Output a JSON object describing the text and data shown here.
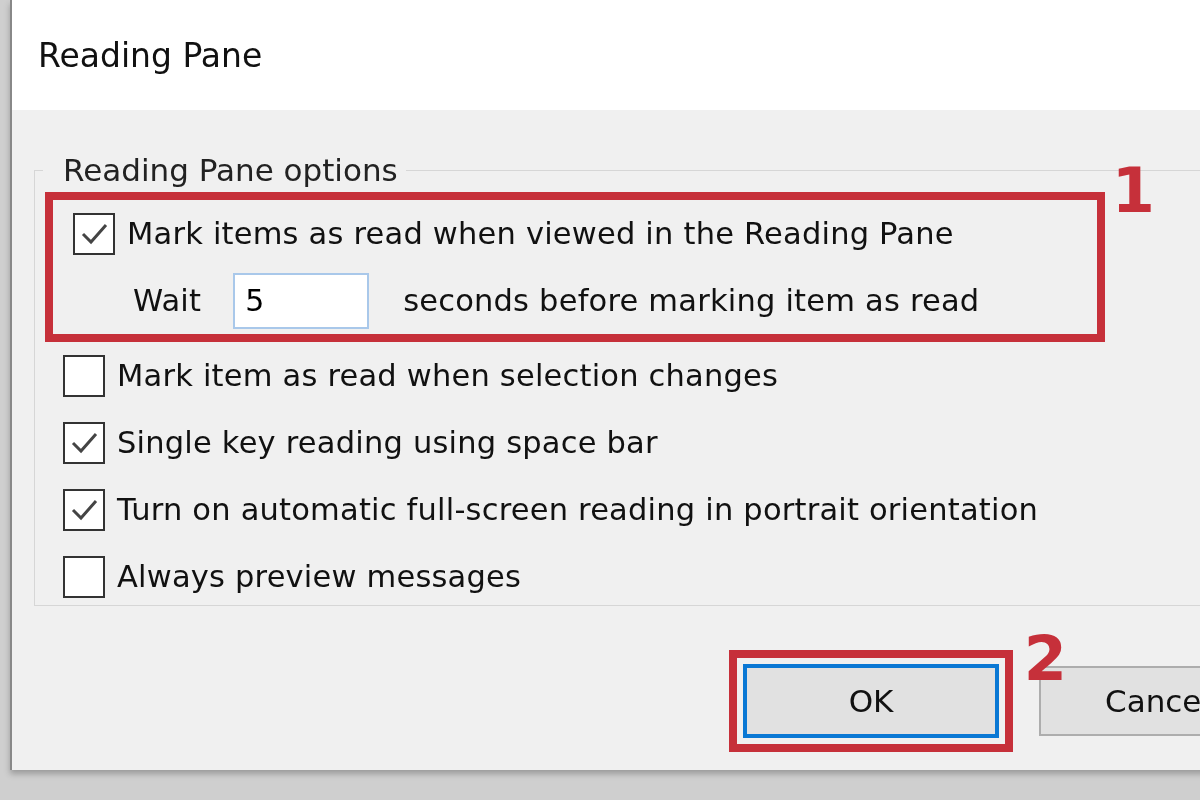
{
  "dialog": {
    "title": "Reading Pane"
  },
  "group": {
    "legend": "Reading Pane options",
    "options": [
      {
        "kind": "checkbox",
        "label": "Mark items as read when viewed in the Reading Pane",
        "checked": true
      },
      {
        "kind": "wait",
        "prefix": "Wait",
        "value": "5",
        "suffix": "seconds before marking item as read"
      },
      {
        "kind": "checkbox",
        "label": "Mark item as read when selection changes",
        "checked": false
      },
      {
        "kind": "checkbox",
        "label": "Single key reading using space bar",
        "checked": true
      },
      {
        "kind": "checkbox",
        "label": "Turn on automatic full-screen reading in portrait orientation",
        "checked": true
      },
      {
        "kind": "checkbox",
        "label": "Always preview messages",
        "checked": false
      }
    ]
  },
  "buttons": [
    {
      "label": "OK",
      "default": true
    },
    {
      "label": "Cance",
      "default": false
    }
  ],
  "callouts": [
    {
      "number": "1"
    },
    {
      "number": "2"
    }
  ]
}
